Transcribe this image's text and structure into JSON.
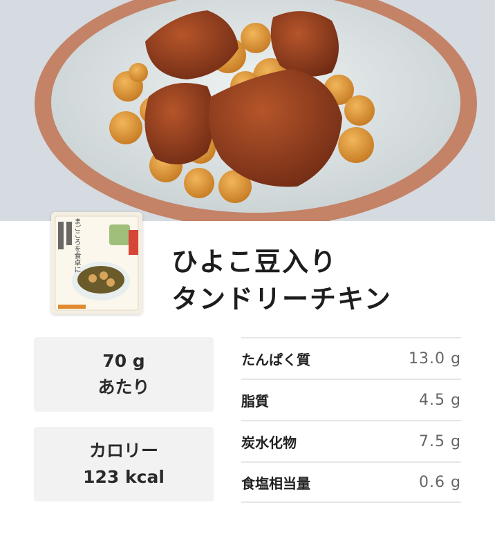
{
  "product": {
    "title_line1": "ひよこ豆入り",
    "title_line2": "タンドリーチキン",
    "package_text": "まごころを食卓に"
  },
  "serving": {
    "amount": "70 g",
    "unit_label": "あたり"
  },
  "calories": {
    "label": "カロリー",
    "value": "123 kcal"
  },
  "nutrition": [
    {
      "label": "たんぱく質",
      "value": "13.0 g"
    },
    {
      "label": "脂質",
      "value": "4.5 g"
    },
    {
      "label": "炭水化物",
      "value": "7.5 g"
    },
    {
      "label": "食塩相当量",
      "value": "0.6 g"
    }
  ],
  "colors": {
    "background": "#ffffff",
    "panel": "#f2f2f2",
    "bowl_rim": "#c9876a",
    "chicken": "#8a3a1e",
    "chickpea": "#d9902e"
  }
}
